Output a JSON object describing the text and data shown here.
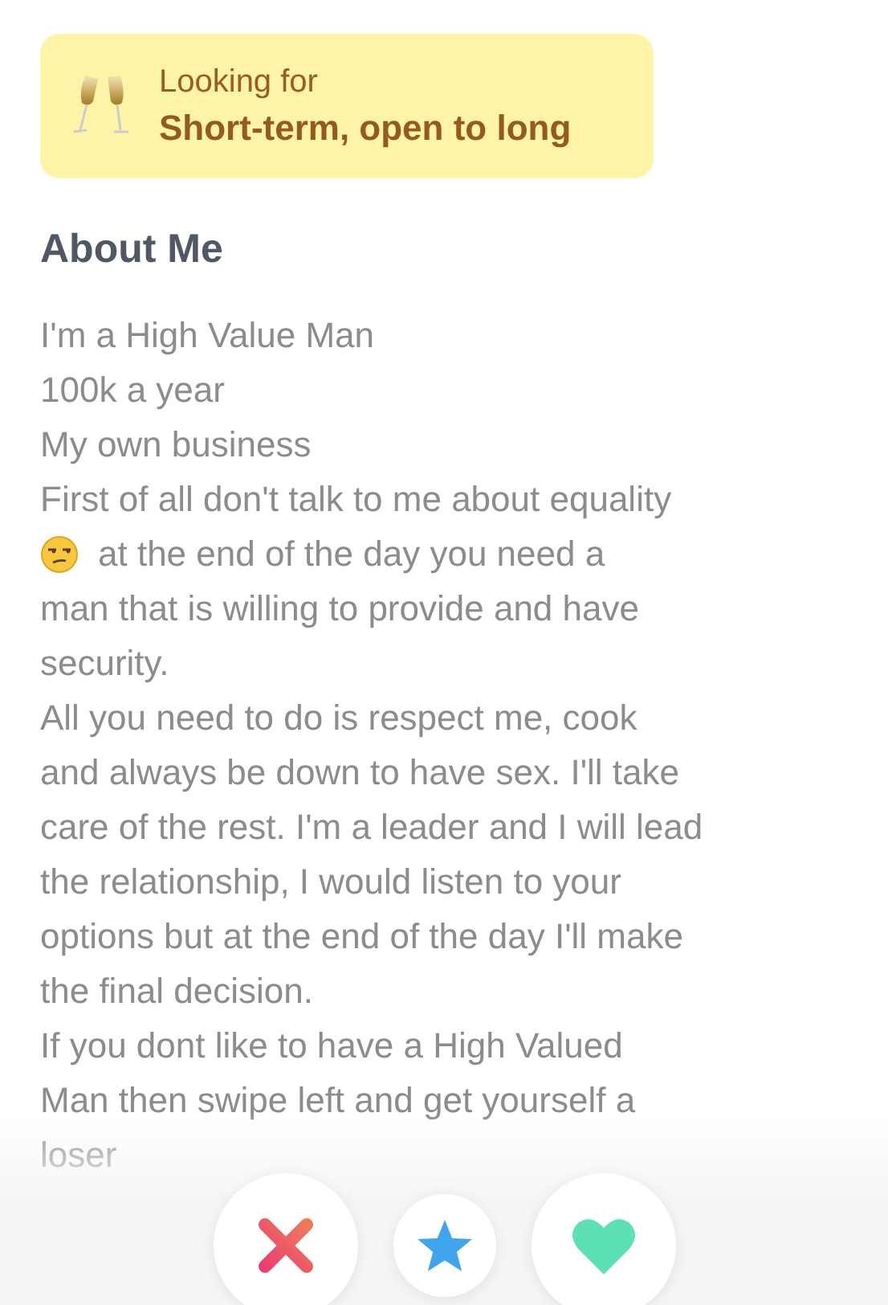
{
  "looking_for": {
    "label": "Looking for",
    "value": "Short-term, open to long"
  },
  "about": {
    "heading": "About Me",
    "lines": [
      {
        "text": "I'm a High Value Man",
        "emoji": false
      },
      {
        "text": "100k a year",
        "emoji": false
      },
      {
        "text": "My own business",
        "emoji": false
      },
      {
        "text": "First of all don't talk to me about equality",
        "emoji": false
      },
      {
        "text": "at the end of the day you need a",
        "emoji": true
      },
      {
        "text": "man that is willing to provide and have",
        "emoji": false
      },
      {
        "text": "security.",
        "emoji": false
      },
      {
        "text": "All you need to do is respect me, cook",
        "emoji": false
      },
      {
        "text": "and always be down to have sex. I'll take",
        "emoji": false
      },
      {
        "text": "care of the rest. I'm a leader and I will lead",
        "emoji": false
      },
      {
        "text": "the relationship, I would listen to your",
        "emoji": false
      },
      {
        "text": "options but at the end of the day I'll make",
        "emoji": false
      },
      {
        "text": "the final decision.",
        "emoji": false
      },
      {
        "text": "If you dont like to have a High Valued",
        "emoji": false
      },
      {
        "text": "Man then swipe left and get yourself a",
        "emoji": false
      },
      {
        "text": "loser",
        "emoji": false
      }
    ]
  },
  "actions": [
    {
      "kind": "nope"
    },
    {
      "kind": "super"
    },
    {
      "kind": "like"
    }
  ]
}
